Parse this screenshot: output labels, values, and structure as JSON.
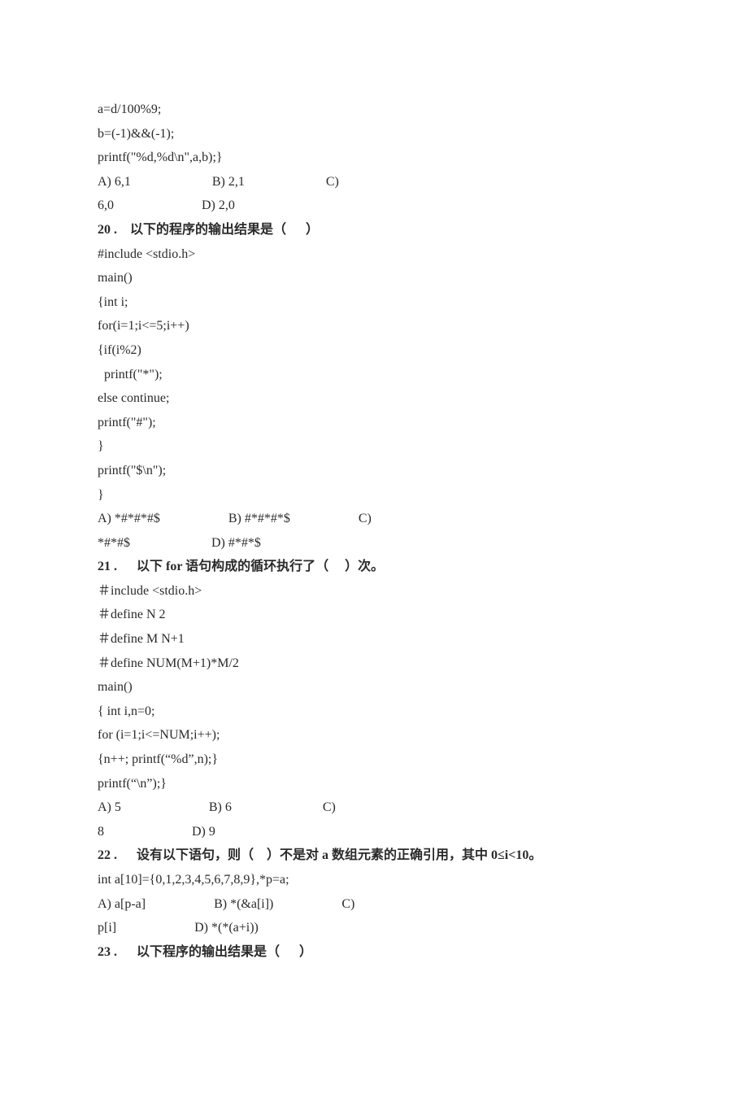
{
  "page": {
    "preamble": {
      "l1": "a=d/100%9;",
      "l2": "b=(-1)&&(-1);",
      "l3": "printf(\"%d,%d\\n\",a,b);}",
      "l4": "A) 6,1                         B) 2,1                         C)",
      "l5": "6,0                           D) 2,0"
    },
    "q20": {
      "heading": "20 .    以下的程序的输出结果是（      ）",
      "code": [
        "#include <stdio.h>",
        "main()",
        "{int i;",
        "for(i=1;i<=5;i++)",
        "{if(i%2)",
        "  printf(\"*\");",
        "else continue;",
        "printf(\"#\");",
        "}",
        "printf(\"$\\n\");",
        "}"
      ],
      "opt1": "A) *#*#*#$                     B) #*#*#*$                     C)",
      "opt2": "*#*#$                         D) #*#*$"
    },
    "q21": {
      "heading": "21 .      以下 for 语句构成的循环执行了（     ）次。",
      "code": [
        "＃include <stdio.h>",
        "＃define N 2",
        "＃define M N+1",
        "＃define NUM(M+1)*M/2",
        "main()",
        "{ int i,n=0;",
        "for (i=1;i<=NUM;i++);",
        "{n++; printf(“%d”,n);}",
        "printf(“\\n”);}"
      ],
      "opt1": "A) 5                           B) 6                            C)",
      "opt2": "8                           D) 9"
    },
    "q22": {
      "heading": "22 .      设有以下语句，则（    ）不是对 a 数组元素的正确引用，其中 0≤i<10。",
      "code": [
        "int a[10]={0,1,2,3,4,5,6,7,8,9},*p=a;"
      ],
      "opt1": "A) a[p-a]                     B) *(&a[i])                     C)",
      "opt2": "p[i]                        D) *(*(a+i))"
    },
    "q23": {
      "heading": "23 .      以下程序的输出结果是（      ）"
    }
  }
}
